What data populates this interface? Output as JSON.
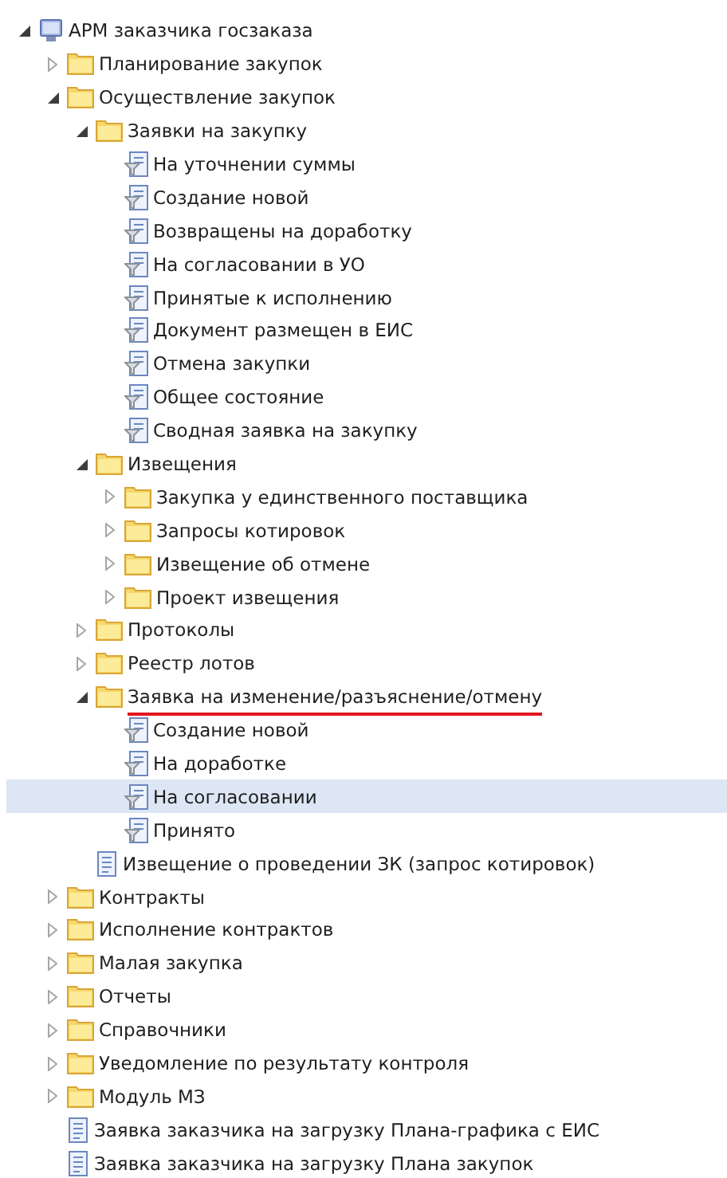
{
  "tree": [
    {
      "label": "АРМ заказчика госзаказа",
      "kind": "computer",
      "expanded": true,
      "selected": false,
      "children": [
        {
          "label": "Планирование закупок",
          "kind": "folder",
          "expanded": false,
          "selected": false
        },
        {
          "label": "Осуществление закупок",
          "kind": "folder",
          "expanded": true,
          "selected": false,
          "children": [
            {
              "label": "Заявки на закупку",
              "kind": "folder",
              "expanded": true,
              "selected": false,
              "children": [
                {
                  "label": "На уточнении суммы",
                  "kind": "filter",
                  "selected": false
                },
                {
                  "label": "Создание новой",
                  "kind": "filter",
                  "selected": false
                },
                {
                  "label": "Возвращены на доработку",
                  "kind": "filter",
                  "selected": false
                },
                {
                  "label": "На согласовании в УО",
                  "kind": "filter",
                  "selected": false
                },
                {
                  "label": "Принятые к исполнению",
                  "kind": "filter",
                  "selected": false
                },
                {
                  "label": "Документ размещен в ЕИС",
                  "kind": "filter",
                  "selected": false
                },
                {
                  "label": "Отмена закупки",
                  "kind": "filter",
                  "selected": false
                },
                {
                  "label": "Общее состояние",
                  "kind": "filter",
                  "selected": false
                },
                {
                  "label": "Сводная заявка на закупку",
                  "kind": "filter",
                  "selected": false
                }
              ]
            },
            {
              "label": "Извещения",
              "kind": "folder",
              "expanded": true,
              "selected": false,
              "children": [
                {
                  "label": "Закупка у единственного поставщика",
                  "kind": "folder",
                  "expanded": false,
                  "selected": false
                },
                {
                  "label": "Запросы котировок",
                  "kind": "folder",
                  "expanded": false,
                  "selected": false
                },
                {
                  "label": "Извещение об отмене",
                  "kind": "folder",
                  "expanded": false,
                  "selected": false
                },
                {
                  "label": "Проект извещения",
                  "kind": "folder",
                  "expanded": false,
                  "selected": false
                }
              ]
            },
            {
              "label": "Протоколы",
              "kind": "folder",
              "expanded": false,
              "selected": false
            },
            {
              "label": "Реестр лотов",
              "kind": "folder",
              "expanded": false,
              "selected": false
            },
            {
              "label": "Заявка на изменение/разъяснение/отмену",
              "kind": "folder",
              "expanded": true,
              "selected": false,
              "underlined": true,
              "children": [
                {
                  "label": "Создание новой",
                  "kind": "filter",
                  "selected": false
                },
                {
                  "label": "На доработке",
                  "kind": "filter",
                  "selected": false
                },
                {
                  "label": "На согласовании",
                  "kind": "filter",
                  "selected": true
                },
                {
                  "label": "Принято",
                  "kind": "filter",
                  "selected": false
                }
              ]
            },
            {
              "label": "Извещение о проведении ЗК (запрос котировок)",
              "kind": "document",
              "selected": false
            }
          ]
        },
        {
          "label": "Контракты",
          "kind": "folder",
          "expanded": false,
          "selected": false
        },
        {
          "label": "Исполнение контрактов",
          "kind": "folder",
          "expanded": false,
          "selected": false
        },
        {
          "label": "Малая закупка",
          "kind": "folder",
          "expanded": false,
          "selected": false
        },
        {
          "label": "Отчеты",
          "kind": "folder",
          "expanded": false,
          "selected": false
        },
        {
          "label": "Справочники",
          "kind": "folder",
          "expanded": false,
          "selected": false
        },
        {
          "label": "Уведомление по результату контроля",
          "kind": "folder",
          "expanded": false,
          "selected": false
        },
        {
          "label": "Модуль МЗ",
          "kind": "folder",
          "expanded": false,
          "selected": false
        },
        {
          "label": "Заявка заказчика на загрузку Плана-графика с ЕИС",
          "kind": "document",
          "selected": false
        },
        {
          "label": "Заявка заказчика на загрузку Плана закупок",
          "kind": "document",
          "selected": false
        }
      ]
    }
  ]
}
